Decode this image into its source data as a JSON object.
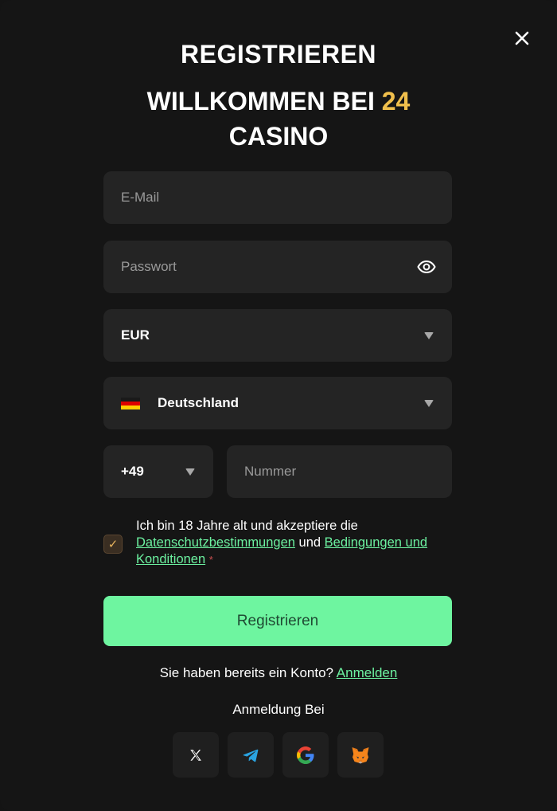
{
  "modal": {
    "title": "REGISTRIEREN",
    "welcome_prefix": "WILLKOMMEN BEI",
    "welcome_accent": "24",
    "welcome_suffix": "CASINO",
    "accent_color": "#f0bf4c"
  },
  "form": {
    "email": {
      "value": "",
      "placeholder": "E-Mail"
    },
    "password": {
      "value": "",
      "placeholder": "Passwort",
      "icon": "eye-icon"
    },
    "currency": {
      "selected": "EUR",
      "icon": "chevron-down-icon"
    },
    "country": {
      "selected": "Deutschland",
      "flag": "germany-flag-icon"
    },
    "phone_code": {
      "selected": "+49"
    },
    "phone_number": {
      "value": "",
      "placeholder": "Nummer"
    }
  },
  "consent": {
    "checked": true,
    "text_before": "Ich bin 18 Jahre alt und akzeptiere die",
    "privacy_link": "Datenschutzbestimmungen",
    "connector": "und",
    "terms_link": "Bedingungen und Konditionen",
    "required_mark": "*",
    "link_color": "#6cf1a0"
  },
  "submit": {
    "label": "Registrieren",
    "color": "#6ef5a0"
  },
  "login_prompt": {
    "text": "Sie haben bereits ein Konto?",
    "link": "Anmelden"
  },
  "social_login": {
    "heading": "Anmeldung Bei",
    "providers": [
      {
        "name": "X",
        "icon": "x-icon"
      },
      {
        "name": "Telegram",
        "icon": "telegram-icon"
      },
      {
        "name": "Google",
        "icon": "google-icon"
      },
      {
        "name": "MetaMask",
        "icon": "metamask-fox-icon"
      }
    ]
  }
}
